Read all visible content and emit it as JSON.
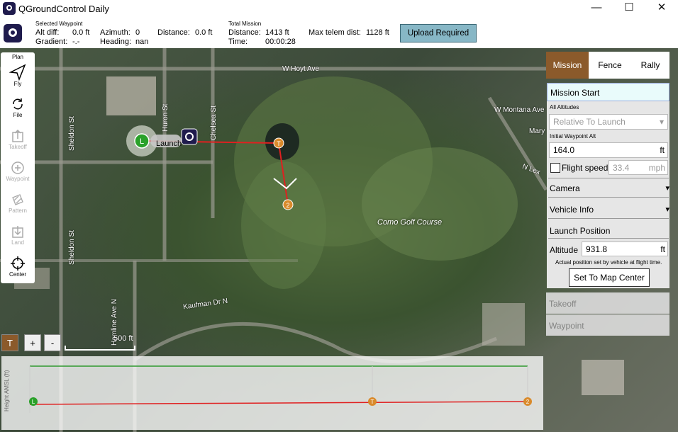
{
  "window": {
    "title": "QGroundControl Daily",
    "controls": {
      "minimize": "—",
      "maximize": "☐",
      "close": "✕"
    }
  },
  "toolbar": {
    "selected_waypoint_caption": "Selected Waypoint",
    "alt_diff_label": "Alt diff:",
    "alt_diff_value": "0.0 ft",
    "gradient_label": "Gradient:",
    "gradient_value": "-.-",
    "azimuth_label": "Azimuth:",
    "azimuth_value": "0",
    "heading_label": "Heading:",
    "heading_value": "nan",
    "distance_label": "Distance:",
    "distance_value": "0.0 ft",
    "total_mission_caption": "Total Mission",
    "total_distance_label": "Distance:",
    "total_distance_value": "1413 ft",
    "time_label": "Time:",
    "time_value": "00:00:28",
    "max_telem_label": "Max telem dist:",
    "max_telem_value": "1128 ft",
    "upload_label": "Upload Required"
  },
  "left_tools": {
    "plan": "Plan",
    "fly": "Fly",
    "file": "File",
    "takeoff": "Takeoff",
    "waypoint": "Waypoint",
    "pattern": "Pattern",
    "land": "Land",
    "center": "Center"
  },
  "map": {
    "streets": {
      "hoyt": "W Hoyt Ave",
      "montana": "W Montana Ave",
      "mary": "Mary",
      "nlex": "N Lex",
      "huron": "Huron St",
      "chelsea": "Chelsea St",
      "sheldon_top": "Sheldon St",
      "sheldon_bottom": "Sheldon St",
      "hamline": "Hamline Ave N",
      "kaufman": "Kaufman Dr N"
    },
    "golf_course": "Como Golf Course",
    "launch_label": "Launch",
    "markers": {
      "launch": "L",
      "takeoff": "T",
      "wp2": "2"
    },
    "scale_label": "500 ft"
  },
  "map_buttons": {
    "terrain": "T",
    "zoom_in": "+",
    "zoom_out": "-"
  },
  "panel": {
    "tabs": [
      "Mission",
      "Fence",
      "Rally"
    ],
    "active_tab": "Mission",
    "header": "Mission Start",
    "all_altitudes_label": "All Altitudes",
    "altitude_mode": "Relative To Launch",
    "initial_wp_alt_label": "Initial Waypoint Alt",
    "initial_wp_alt_value": "164.0",
    "initial_wp_alt_unit": "ft",
    "flight_speed_label": "Flight speed",
    "flight_speed_value": "33.4",
    "flight_speed_unit": "mph",
    "camera_label": "Camera",
    "vehicle_info_label": "Vehicle Info",
    "launch_position_label": "Launch Position",
    "altitude_label": "Altitude",
    "altitude_value": "931.8",
    "altitude_unit": "ft",
    "launch_note": "Actual position set by vehicle at flight time.",
    "set_center_label": "Set To Map Center",
    "takeoff_label": "Takeoff",
    "waypoint_label": "Waypoint"
  },
  "profile": {
    "y_axis_label": "Height AMSL (ft)",
    "markers": {
      "launch": "L",
      "takeoff": "T",
      "wp2": "2"
    }
  },
  "colors": {
    "accent_brown": "#8b5a2b",
    "path_red": "#e02020",
    "terrain_green": "#2e9a2e",
    "launch_green": "#2aa12a",
    "waypoint_orange": "#d98a2b",
    "upload_blue": "#87b7c6"
  }
}
